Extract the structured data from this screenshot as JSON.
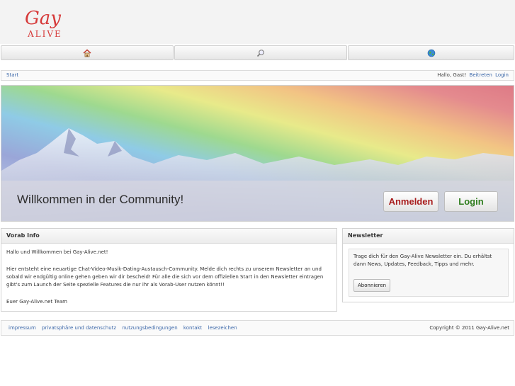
{
  "logo": {
    "line1": "Gay",
    "line2": "ALIVE"
  },
  "nav": {
    "items": [
      {
        "icon": "home-icon"
      },
      {
        "icon": "search-icon"
      },
      {
        "icon": "globe-icon"
      }
    ]
  },
  "breadcrumb": {
    "start": "Start",
    "greeting": "Hallo, Gast!",
    "join": "Beitreten",
    "login": "Login"
  },
  "hero": {
    "title": "Willkommen in der Community!",
    "register_label": "Anmelden",
    "login_label": "Login"
  },
  "intro": {
    "header": "Vorab Info",
    "p1": "Hallo und Willkommen bei Gay-Alive.net!",
    "p2": "Hier entsteht eine neuartige Chat-Video-Musik-Dating-Austausch-Community. Melde dich rechts zu unserem Newsletter an und sobald wir endgültig online gehen geben wir dir bescheid! Für alle die sich vor dem offiziellen Start in den Newsletter eintragen gibt's zum Launch der Seite spezielle Features die nur ihr als Vorab-User nutzen könnt!!",
    "p3": "Euer Gay-Alive.net Team"
  },
  "newsletter": {
    "header": "Newsletter",
    "text": "Trage dich für den Gay-Alive Newsletter ein. Du erhältst dann News, Updates, Feedback, Tipps und mehr.",
    "button": "Abonnieren"
  },
  "footer": {
    "links": [
      "impressum",
      "privatsphäre und datenschutz",
      "nutzungsbedingungen",
      "kontakt",
      "lesezeichen"
    ],
    "copyright": "Copyright © 2011 Gay-Alive.net"
  },
  "colors": {
    "link": "#3a66a8",
    "logo_red": "#d63a3a",
    "register": "#a81c1c",
    "login": "#2f7d1e"
  }
}
